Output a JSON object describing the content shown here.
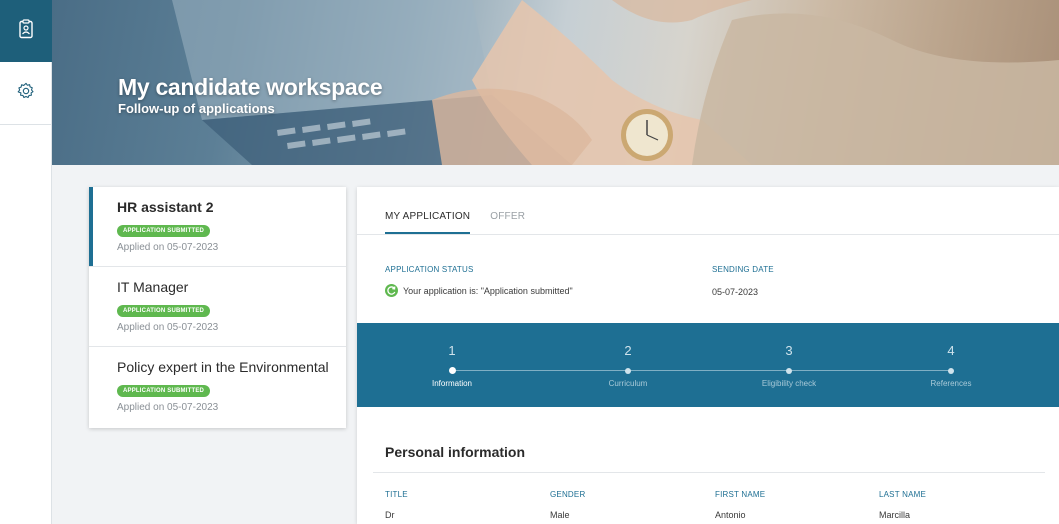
{
  "rail": {
    "items": [
      {
        "icon": "clipboard-badge-icon",
        "active": true
      },
      {
        "icon": "gear-icon",
        "active": false
      }
    ]
  },
  "hero": {
    "title": "My candidate workspace",
    "subtitle": "Follow-up of applications"
  },
  "applications": [
    {
      "title": "HR assistant 2",
      "status": "APPLICATION SUBMITTED",
      "applied": "Applied on 05-07-2023",
      "selected": true
    },
    {
      "title": "IT Manager",
      "status": "APPLICATION SUBMITTED",
      "applied": "Applied on 05-07-2023",
      "selected": false
    },
    {
      "title": "Policy expert in the Environmental",
      "status": "APPLICATION SUBMITTED",
      "applied": "Applied on 05-07-2023",
      "selected": false
    }
  ],
  "detail": {
    "tabs": [
      {
        "label": "MY APPLICATION",
        "active": true
      },
      {
        "label": "OFFER",
        "active": false
      }
    ],
    "status_label": "APPLICATION STATUS",
    "status_value": "Your application is: \"Application submitted\"",
    "sending_label": "SENDING DATE",
    "sending_value": "05-07-2023",
    "steps": [
      {
        "num": "1",
        "label": "Information",
        "active": true
      },
      {
        "num": "2",
        "label": "Curriculum",
        "active": false
      },
      {
        "num": "3",
        "label": "Eligibility check",
        "active": false
      },
      {
        "num": "4",
        "label": "References",
        "active": false
      }
    ],
    "section_title": "Personal information",
    "fields": [
      {
        "label": "TITLE",
        "value": "Dr"
      },
      {
        "label": "GENDER",
        "value": "Male"
      },
      {
        "label": "FIRST NAME",
        "value": "Antonio"
      },
      {
        "label": "LAST NAME",
        "value": "Marcilla"
      }
    ]
  },
  "colors": {
    "primary": "#1e6f93",
    "rail_active": "#1e5f7a",
    "badge": "#5fb84f"
  }
}
